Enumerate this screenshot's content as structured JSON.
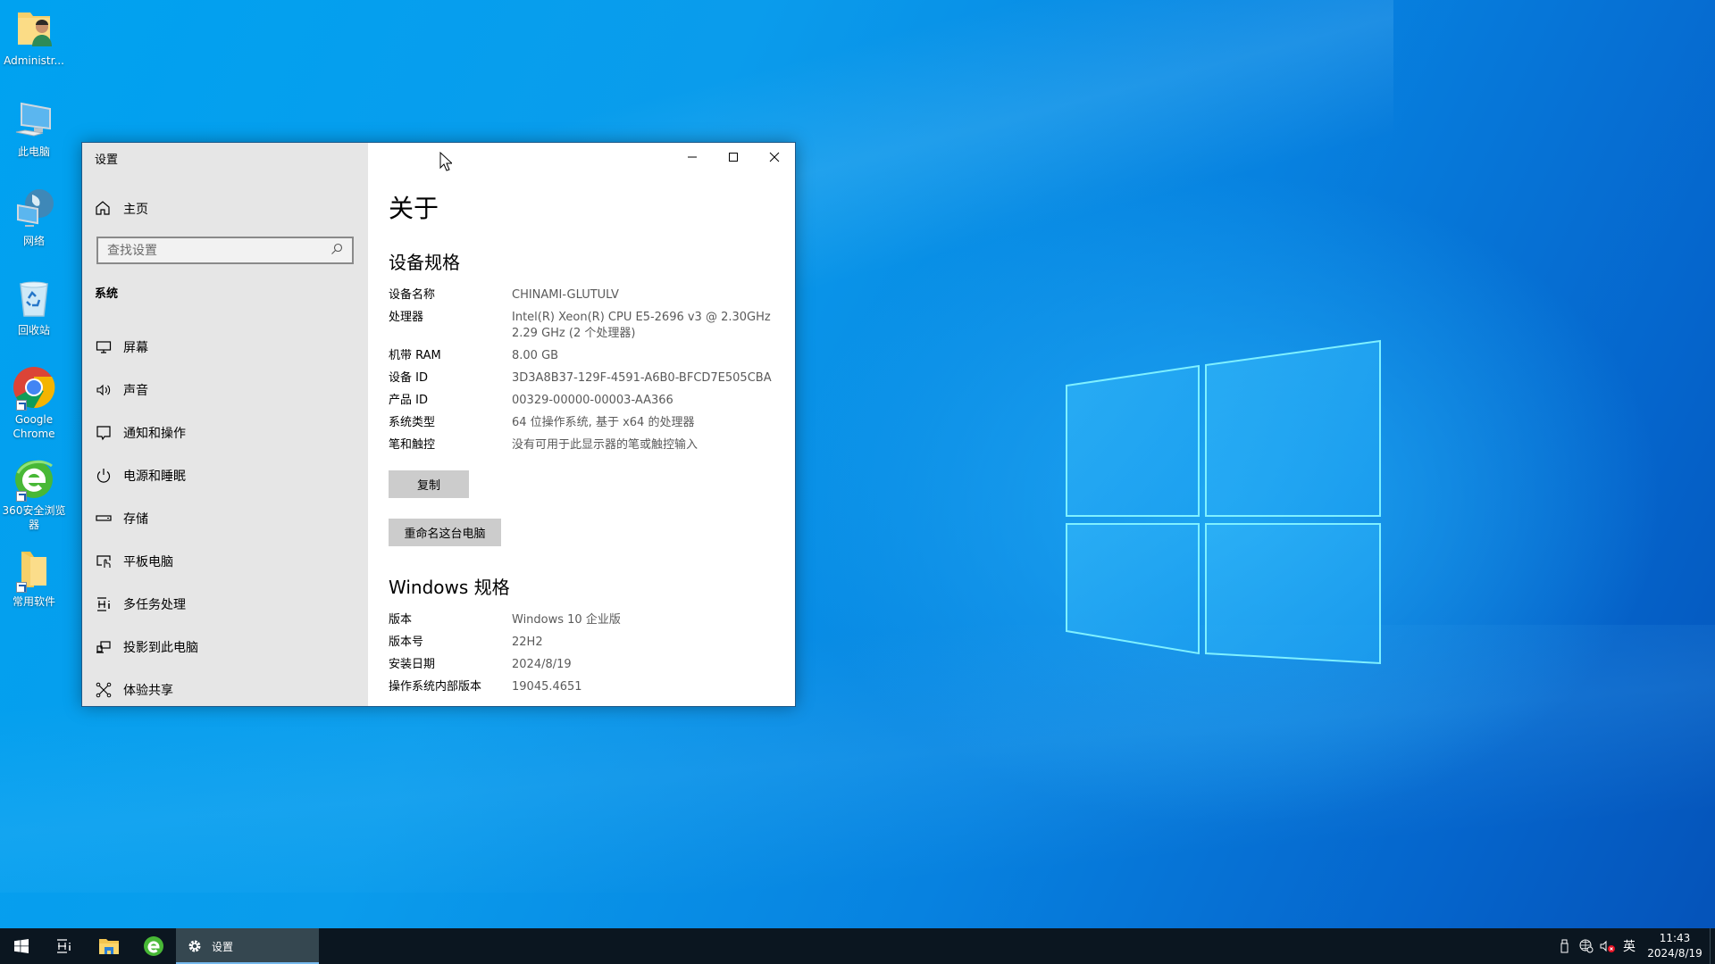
{
  "desktop": {
    "icons": [
      {
        "label": "Administr...",
        "icon": "user-folder-icon"
      },
      {
        "label": "此电脑",
        "icon": "this-pc-icon"
      },
      {
        "label": "网络",
        "icon": "network-icon"
      },
      {
        "label": "回收站",
        "icon": "recycle-bin-icon"
      },
      {
        "label": "Google Chrome",
        "icon": "chrome-icon",
        "shortcut": true
      },
      {
        "label": "360安全浏览器",
        "icon": "360-browser-icon",
        "shortcut": true
      },
      {
        "label": "常用软件",
        "icon": "folder-icon",
        "shortcut": true
      }
    ]
  },
  "window": {
    "app_title": "设置",
    "caption": {
      "minimize": "minimize",
      "maximize": "maximize",
      "close": "close"
    },
    "sidebar": {
      "home_label": "主页",
      "search_placeholder": "查找设置",
      "section_label": "系统",
      "items": [
        {
          "label": "屏幕",
          "icon": "display-icon"
        },
        {
          "label": "声音",
          "icon": "speaker-icon"
        },
        {
          "label": "通知和操作",
          "icon": "notification-icon"
        },
        {
          "label": "电源和睡眠",
          "icon": "power-icon"
        },
        {
          "label": "存储",
          "icon": "storage-icon"
        },
        {
          "label": "平板电脑",
          "icon": "tablet-icon"
        },
        {
          "label": "多任务处理",
          "icon": "multitasking-icon"
        },
        {
          "label": "投影到此电脑",
          "icon": "project-icon"
        },
        {
          "label": "体验共享",
          "icon": "shared-experiences-icon"
        }
      ]
    },
    "content": {
      "page_title": "关于",
      "device_specs": {
        "heading": "设备规格",
        "rows": [
          {
            "key": "设备名称",
            "value": "CHINAMI-GLUTULV"
          },
          {
            "key": "处理器",
            "value": "Intel(R) Xeon(R) CPU E5-2696 v3 @ 2.30GHz",
            "value2": "2.29 GHz  (2 个处理器)"
          },
          {
            "key": "机带 RAM",
            "value": "8.00 GB"
          },
          {
            "key": "设备 ID",
            "value": "3D3A8B37-129F-4591-A6B0-BFCD7E505CBA"
          },
          {
            "key": "产品 ID",
            "value": "00329-00000-00003-AA366"
          },
          {
            "key": "系统类型",
            "value": "64 位操作系统, 基于 x64 的处理器"
          },
          {
            "key": "笔和触控",
            "value": "没有可用于此显示器的笔或触控输入"
          }
        ],
        "copy_button": "复制",
        "rename_button": "重命名这台电脑"
      },
      "windows_specs": {
        "heading": "Windows 规格",
        "rows": [
          {
            "key": "版本",
            "value": "Windows 10 企业版"
          },
          {
            "key": "版本号",
            "value": "22H2"
          },
          {
            "key": "安装日期",
            "value": "2024/8/19"
          },
          {
            "key": "操作系统内部版本",
            "value": "19045.4651"
          }
        ]
      }
    }
  },
  "taskbar": {
    "running_task_label": "设置",
    "tray": {
      "ime_label": "英",
      "time": "11:43",
      "date": "2024/8/19"
    }
  }
}
